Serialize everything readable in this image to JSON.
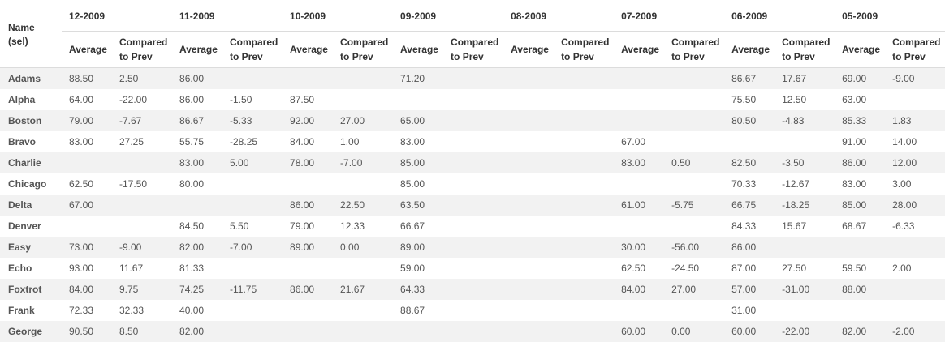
{
  "table": {
    "name_header": "Name (sel)",
    "name_header_line1": "Name",
    "name_header_line2": "(sel)",
    "months": [
      "12-2009",
      "11-2009",
      "10-2009",
      "09-2009",
      "08-2009",
      "07-2009",
      "06-2009",
      "05-2009"
    ],
    "sub_avg": "Average",
    "sub_cmp_line1": "Compared",
    "sub_cmp_line2": "to Prev",
    "rows": [
      {
        "name": "Adams",
        "cells": [
          "88.50",
          "2.50",
          "86.00",
          "",
          "",
          "",
          "71.20",
          "",
          "",
          "",
          "",
          "",
          "86.67",
          "17.67",
          "69.00",
          "-9.00"
        ]
      },
      {
        "name": "Alpha",
        "cells": [
          "64.00",
          "-22.00",
          "86.00",
          "-1.50",
          "87.50",
          "",
          "",
          "",
          "",
          "",
          "",
          "",
          "75.50",
          "12.50",
          "63.00",
          ""
        ]
      },
      {
        "name": "Boston",
        "cells": [
          "79.00",
          "-7.67",
          "86.67",
          "-5.33",
          "92.00",
          "27.00",
          "65.00",
          "",
          "",
          "",
          "",
          "",
          "80.50",
          "-4.83",
          "85.33",
          "1.83"
        ]
      },
      {
        "name": "Bravo",
        "cells": [
          "83.00",
          "27.25",
          "55.75",
          "-28.25",
          "84.00",
          "1.00",
          "83.00",
          "",
          "",
          "",
          "67.00",
          "",
          "",
          "",
          "91.00",
          "14.00"
        ]
      },
      {
        "name": "Charlie",
        "cells": [
          "",
          "",
          "83.00",
          "5.00",
          "78.00",
          "-7.00",
          "85.00",
          "",
          "",
          "",
          "83.00",
          "0.50",
          "82.50",
          "-3.50",
          "86.00",
          "12.00"
        ]
      },
      {
        "name": "Chicago",
        "cells": [
          "62.50",
          "-17.50",
          "80.00",
          "",
          "",
          "",
          "85.00",
          "",
          "",
          "",
          "",
          "",
          "70.33",
          "-12.67",
          "83.00",
          "3.00"
        ]
      },
      {
        "name": "Delta",
        "cells": [
          "67.00",
          "",
          "",
          "",
          "86.00",
          "22.50",
          "63.50",
          "",
          "",
          "",
          "61.00",
          "-5.75",
          "66.75",
          "-18.25",
          "85.00",
          "28.00"
        ]
      },
      {
        "name": "Denver",
        "cells": [
          "",
          "",
          "84.50",
          "5.50",
          "79.00",
          "12.33",
          "66.67",
          "",
          "",
          "",
          "",
          "",
          "84.33",
          "15.67",
          "68.67",
          "-6.33"
        ]
      },
      {
        "name": "Easy",
        "cells": [
          "73.00",
          "-9.00",
          "82.00",
          "-7.00",
          "89.00",
          "0.00",
          "89.00",
          "",
          "",
          "",
          "30.00",
          "-56.00",
          "86.00",
          "",
          "",
          ""
        ]
      },
      {
        "name": "Echo",
        "cells": [
          "93.00",
          "11.67",
          "81.33",
          "",
          "",
          "",
          "59.00",
          "",
          "",
          "",
          "62.50",
          "-24.50",
          "87.00",
          "27.50",
          "59.50",
          "2.00"
        ]
      },
      {
        "name": "Foxtrot",
        "cells": [
          "84.00",
          "9.75",
          "74.25",
          "-11.75",
          "86.00",
          "21.67",
          "64.33",
          "",
          "",
          "",
          "84.00",
          "27.00",
          "57.00",
          "-31.00",
          "88.00",
          ""
        ]
      },
      {
        "name": "Frank",
        "cells": [
          "72.33",
          "32.33",
          "40.00",
          "",
          "",
          "",
          "88.67",
          "",
          "",
          "",
          "",
          "",
          "31.00",
          "",
          "",
          ""
        ]
      },
      {
        "name": "George",
        "cells": [
          "90.50",
          "8.50",
          "82.00",
          "",
          "",
          "",
          "",
          "",
          "",
          "",
          "60.00",
          "0.00",
          "60.00",
          "-22.00",
          "82.00",
          "-2.00"
        ]
      }
    ]
  }
}
